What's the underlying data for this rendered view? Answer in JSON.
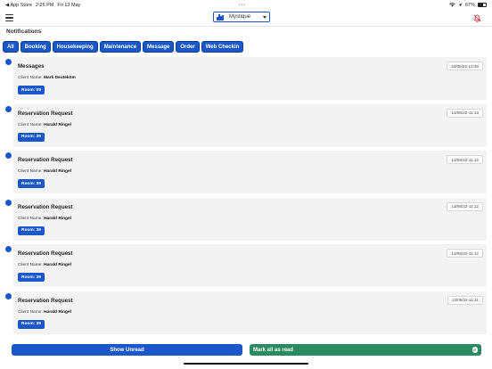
{
  "status_bar": {
    "back_app": "◀ App Store",
    "time": "2:26 PM",
    "date": "Fri 13 May",
    "battery_text": "67%",
    "battery_level": 0.67
  },
  "header": {
    "hotel_name": "Mystique"
  },
  "section_title": "Notifications",
  "tabs": [
    "All",
    "Booking",
    "Housekeeping",
    "Maintenance",
    "Message",
    "Order",
    "Web Checkin"
  ],
  "client_label": "Client Name: ",
  "notifications": [
    {
      "title": "Messages",
      "client": "Mark Deuteköm",
      "room": "Room: 09",
      "date": "13/05/22-13:48"
    },
    {
      "title": "Reservation Request",
      "client": "Harald Ringel",
      "room": "Room: 39",
      "date": "13/05/22-11:13"
    },
    {
      "title": "Reservation Request",
      "client": "Harald Ringel",
      "room": "Room: 39",
      "date": "13/05/22-11:12"
    },
    {
      "title": "Reservation Request",
      "client": "Harald Ringel",
      "room": "Room: 39",
      "date": "13/05/22-11:12"
    },
    {
      "title": "Reservation Request",
      "client": "Harald Ringel",
      "room": "Room: 39",
      "date": "13/05/22-11:12"
    },
    {
      "title": "Reservation Request",
      "client": "Harald Ringel",
      "room": "Room: 39",
      "date": "13/05/22-11:11"
    }
  ],
  "actions": {
    "show_unread": "Show Unread",
    "mark_all_read": "Mark all as read"
  },
  "colors": {
    "accent": "#1a57c9",
    "success": "#2a8a62"
  },
  "icons": [
    "hamburger-icon",
    "hotel-icon",
    "chevron-down-icon",
    "notification-bell-icon",
    "check-circle-icon",
    "wifi-icon",
    "battery-icon"
  ]
}
